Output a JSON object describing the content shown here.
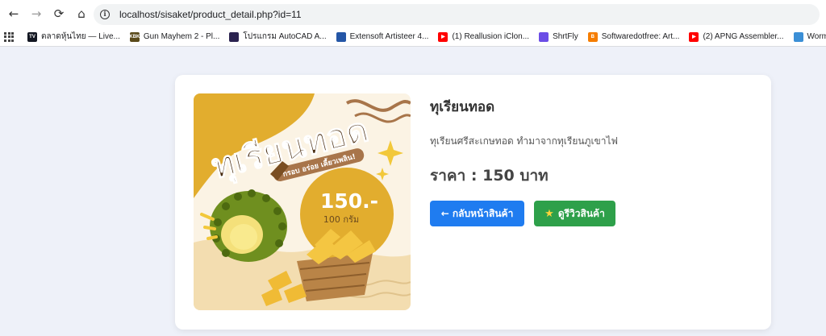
{
  "browser": {
    "url": "localhost/sisaket/product_detail.php?id=11",
    "nav": {
      "back": "←",
      "forward": "→",
      "reload": "⟳",
      "home": "⌂"
    },
    "bookmarks": [
      {
        "label": "ตลาดหุ้นไทย — Live...",
        "fav_text": "TV",
        "fav_color": "#131722"
      },
      {
        "label": "Gun Mayhem 2 - Pl...",
        "fav_text": "KBK",
        "fav_color": "#5a4a1a"
      },
      {
        "label": "โปรแกรม AutoCAD A...",
        "fav_text": "",
        "fav_color": "#2b2350"
      },
      {
        "label": "Extensoft Artisteer 4...",
        "fav_text": "",
        "fav_color": "#2456a6"
      },
      {
        "label": "(1) Reallusion iClon...",
        "fav_text": "▶",
        "fav_color": "#ff0000"
      },
      {
        "label": "ShrtFly",
        "fav_text": "",
        "fav_color": "#6b4de6"
      },
      {
        "label": "Softwaredotfree: Art...",
        "fav_text": "B",
        "fav_color": "#f57d00"
      },
      {
        "label": "(2) APNG Assembler...",
        "fav_text": "▶",
        "fav_color": "#ff0000"
      },
      {
        "label": "Wormate.io Advent...",
        "fav_text": "",
        "fav_color": "#3b8fd6"
      }
    ]
  },
  "product": {
    "name": "ทุเรียนทอด",
    "description": "ทุเรียนศรีสะเกษทอด ทำมาจากทุเรียนภูเขาไฟ",
    "price_label": "ราคา :",
    "price_value": "150",
    "price_unit": "บาท",
    "image": {
      "headline": "ทุเรียนทอด",
      "tagline": "กรอบ อร่อย เคี้ยวเพลิน!",
      "price_badge": "150.-",
      "weight": "100 กรัม"
    }
  },
  "buttons": {
    "back": "← กลับหน้าสินค้า",
    "review_icon": "★",
    "review": "ดูรีวิวสินค้า"
  },
  "colors": {
    "page_bg": "#eef1f9",
    "back_button": "#1f7cf0",
    "review_button": "#2ea04a",
    "image_accent": "#e2ad2e"
  }
}
